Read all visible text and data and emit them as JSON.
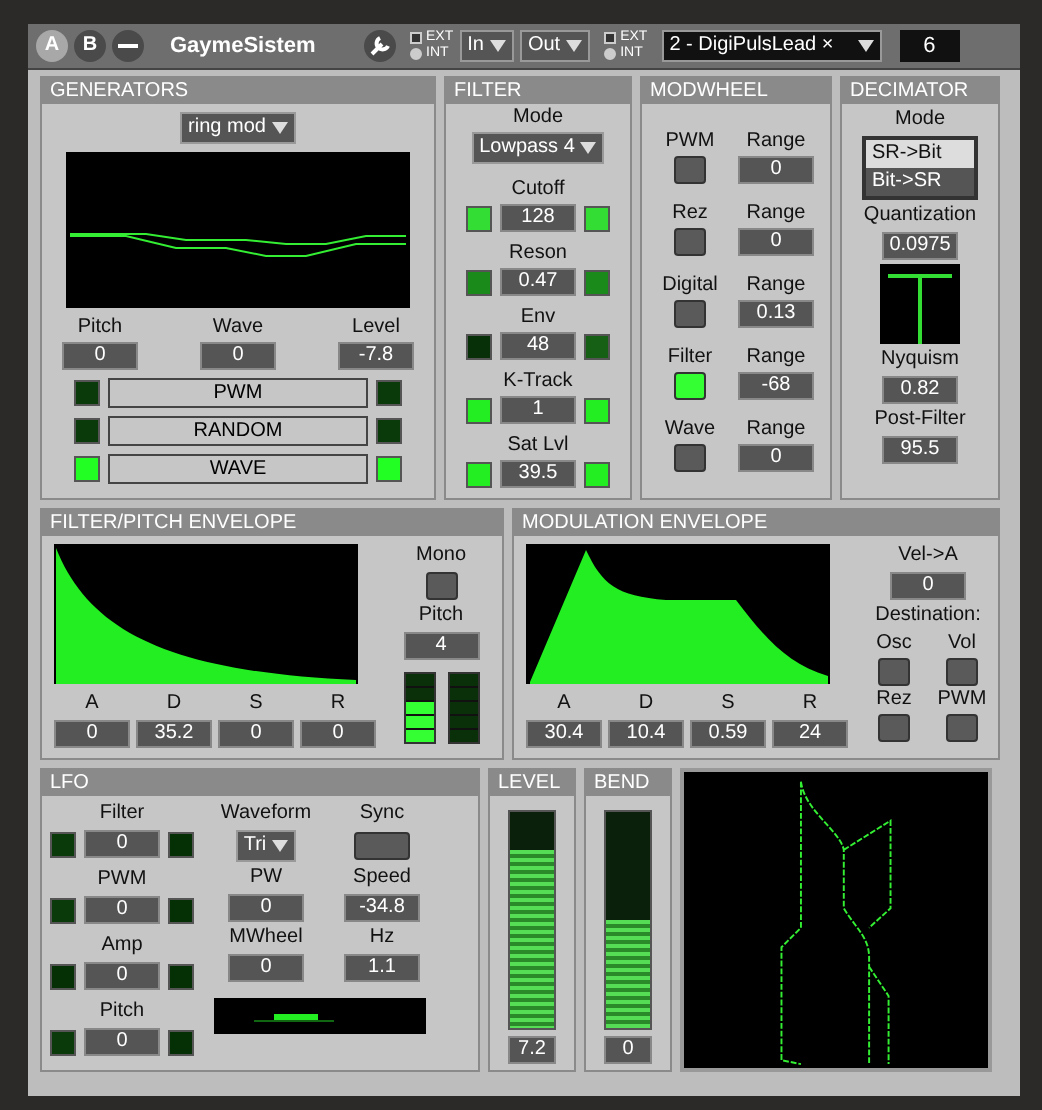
{
  "toolbar": {
    "slots": [
      {
        "label": "A",
        "selected": true
      },
      {
        "label": "B",
        "selected": false
      }
    ],
    "instrument_name": "GaymeSistem",
    "sync_in": [
      {
        "label": "EXT",
        "selected": false
      },
      {
        "label": "INT",
        "selected": true
      }
    ],
    "input": "In",
    "output": "Out",
    "sync_out": [
      {
        "label": "EXT",
        "selected": false
      },
      {
        "label": "INT",
        "selected": true
      }
    ],
    "patch": "2 - DigiPulsLead ×",
    "channel": "6"
  },
  "generators": {
    "title": "GENERATORS",
    "mode": "ring mod",
    "params": [
      {
        "label": "Pitch",
        "value": "0"
      },
      {
        "label": "Wave",
        "value": "0"
      },
      {
        "label": "Level",
        "value": "-7.8"
      }
    ],
    "mods": [
      {
        "label": "PWM",
        "leds": [
          {
            "color": "#0a3a0a"
          },
          {
            "color": "#0a3a0a"
          }
        ]
      },
      {
        "label": "RANDOM",
        "leds": [
          {
            "color": "#0a3a0a"
          },
          {
            "color": "#0a3a0a"
          }
        ]
      },
      {
        "label": "WAVE",
        "leds": [
          {
            "color": "#22ff22"
          },
          {
            "color": "#22ff22"
          }
        ]
      }
    ]
  },
  "filter": {
    "title": "FILTER",
    "mode_label": "Mode",
    "mode": "Lowpass 4",
    "params": [
      {
        "label": "Cutoff",
        "value": "128",
        "leds": [
          {
            "color": "#33dd33"
          },
          {
            "color": "#33dd33"
          }
        ]
      },
      {
        "label": "Reson",
        "value": "0.47",
        "leds": [
          {
            "color": "#1a8a1a"
          },
          {
            "color": "#1a8a1a"
          }
        ]
      },
      {
        "label": "Env",
        "value": "48",
        "leds": [
          {
            "color": "#083008"
          },
          {
            "color": "#156015"
          }
        ]
      },
      {
        "label": "K-Track",
        "value": "1",
        "leds": [
          {
            "color": "#22ee22"
          },
          {
            "color": "#22ee22"
          }
        ]
      },
      {
        "label": "Sat Lvl",
        "value": "39.5",
        "leds": [
          {
            "color": "#22ee22"
          },
          {
            "color": "#22ee22"
          }
        ]
      }
    ]
  },
  "modwheel": {
    "title": "MODWHEEL",
    "rows": [
      {
        "label": "PWM",
        "range_label": "Range",
        "value": "0",
        "on": false
      },
      {
        "label": "Rez",
        "range_label": "Range",
        "value": "0",
        "on": false
      },
      {
        "label": "Digital",
        "range_label": "Range",
        "value": "0.13",
        "on": false
      },
      {
        "label": "Filter",
        "range_label": "Range",
        "value": "-68",
        "on": true
      },
      {
        "label": "Wave",
        "range_label": "Range",
        "value": "0",
        "on": false
      }
    ]
  },
  "decimator": {
    "title": "DECIMATOR",
    "mode_label": "Mode",
    "modes": [
      {
        "label": "SR->Bit",
        "selected": true
      },
      {
        "label": "Bit->SR",
        "selected": false
      }
    ],
    "params": [
      {
        "label": "Quantization",
        "value": "0.0975"
      },
      {
        "label": "Nyquism",
        "value": "0.82"
      },
      {
        "label": "Post-Filter",
        "value": "95.5"
      }
    ]
  },
  "filter_envelope": {
    "title": "FILTER/PITCH ENVELOPE",
    "adsr": [
      {
        "label": "A",
        "value": "0"
      },
      {
        "label": "D",
        "value": "35.2"
      },
      {
        "label": "S",
        "value": "0"
      },
      {
        "label": "R",
        "value": "0"
      }
    ],
    "mono_label": "Mono",
    "mono": false,
    "pitch_label": "Pitch",
    "pitch": "4",
    "meters": [
      {
        "level": 0.6
      },
      {
        "level": 0
      }
    ]
  },
  "mod_envelope": {
    "title": "MODULATION ENVELOPE",
    "adsr": [
      {
        "label": "A",
        "value": "30.4"
      },
      {
        "label": "D",
        "value": "10.4"
      },
      {
        "label": "S",
        "value": "0.59"
      },
      {
        "label": "R",
        "value": "24"
      }
    ],
    "vel_label": "Vel->A",
    "vel": "0",
    "destination_label": "Destination:",
    "destinations": [
      {
        "label": "Osc",
        "on": false
      },
      {
        "label": "Vol",
        "on": false
      },
      {
        "label": "Rez",
        "on": false
      },
      {
        "label": "PWM",
        "on": false
      }
    ]
  },
  "lfo": {
    "title": "LFO",
    "targets": [
      {
        "label": "Filter",
        "value": "0",
        "leds": [
          {
            "color": "#0a3a0a"
          },
          {
            "color": "#053005"
          }
        ]
      },
      {
        "label": "PWM",
        "value": "0",
        "leds": [
          {
            "color": "#0a3a0a"
          },
          {
            "color": "#053005"
          }
        ]
      },
      {
        "label": "Amp",
        "value": "0",
        "leds": [
          {
            "color": "#053005"
          },
          {
            "color": "#053005"
          }
        ]
      },
      {
        "label": "Pitch",
        "value": "0",
        "leds": [
          {
            "color": "#0a3a0a"
          },
          {
            "color": "#053005"
          }
        ]
      }
    ],
    "waveform_label": "Waveform",
    "waveform": "Tri",
    "sync_label": "Sync",
    "sync": false,
    "params": [
      {
        "label": "PW",
        "value": "0"
      },
      {
        "label": "Speed",
        "value": "-34.8"
      },
      {
        "label": "MWheel",
        "value": "0"
      },
      {
        "label": "Hz",
        "value": "1.1"
      }
    ]
  },
  "level": {
    "title": "LEVEL",
    "level": 0.82,
    "value": "7.2"
  },
  "bend": {
    "title": "BEND",
    "level": 0.5,
    "value": "0"
  }
}
